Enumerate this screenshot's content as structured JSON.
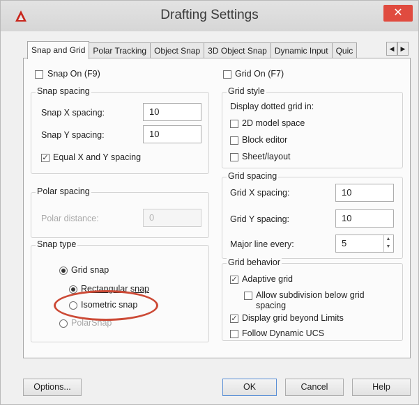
{
  "window": {
    "title": "Drafting Settings",
    "close_label": "✕"
  },
  "tabs": [
    {
      "label": "Snap and Grid",
      "active": true
    },
    {
      "label": "Polar Tracking",
      "active": false
    },
    {
      "label": "Object Snap",
      "active": false
    },
    {
      "label": "3D Object Snap",
      "active": false
    },
    {
      "label": "Dynamic Input",
      "active": false
    },
    {
      "label": "Quic",
      "active": false
    }
  ],
  "tab_nav": {
    "prev": "◀",
    "next": "▶"
  },
  "snap": {
    "snap_on": {
      "label": "Snap On (F9)",
      "checked": false
    },
    "spacing": {
      "title": "Snap spacing",
      "x_label": "Snap X spacing:",
      "x_value": "10",
      "y_label": "Snap Y spacing:",
      "y_value": "10",
      "equal": {
        "label": "Equal X and Y spacing",
        "checked": true
      }
    },
    "polar": {
      "title": "Polar spacing",
      "distance_label": "Polar distance:",
      "distance_value": "0"
    },
    "type": {
      "title": "Snap type",
      "grid_snap": {
        "label": "Grid snap",
        "selected": true
      },
      "rectangular": {
        "label": "Rectangular snap",
        "selected": true
      },
      "isometric": {
        "label": "Isometric snap",
        "selected": false
      },
      "polarsnap": {
        "label": "PolarSnap",
        "selected": false
      }
    }
  },
  "grid": {
    "grid_on": {
      "label": "Grid On (F7)",
      "checked": false
    },
    "style": {
      "title": "Grid style",
      "intro": "Display dotted grid in:",
      "model": {
        "label": "2D model space",
        "checked": false
      },
      "block": {
        "label": "Block editor",
        "checked": false
      },
      "sheet": {
        "label": "Sheet/layout",
        "checked": false
      }
    },
    "spacing": {
      "title": "Grid spacing",
      "x_label": "Grid X spacing:",
      "x_value": "10",
      "y_label": "Grid Y spacing:",
      "y_value": "10",
      "major_label": "Major line every:",
      "major_value": "5"
    },
    "behavior": {
      "title": "Grid behavior",
      "adaptive": {
        "label": "Adaptive grid",
        "checked": true
      },
      "subdivision": {
        "label_line1": "Allow subdivision below grid",
        "label_line2": "spacing",
        "checked": false
      },
      "beyond": {
        "label": "Display grid beyond Limits",
        "checked": true
      },
      "follow": {
        "label": "Follow Dynamic UCS",
        "checked": false
      }
    }
  },
  "buttons": {
    "options": "Options...",
    "ok": "OK",
    "cancel": "Cancel",
    "help": "Help"
  },
  "colors": {
    "close": "#e04b3f",
    "annotation": "#cc4a36",
    "ok_border": "#5a8fd6"
  }
}
